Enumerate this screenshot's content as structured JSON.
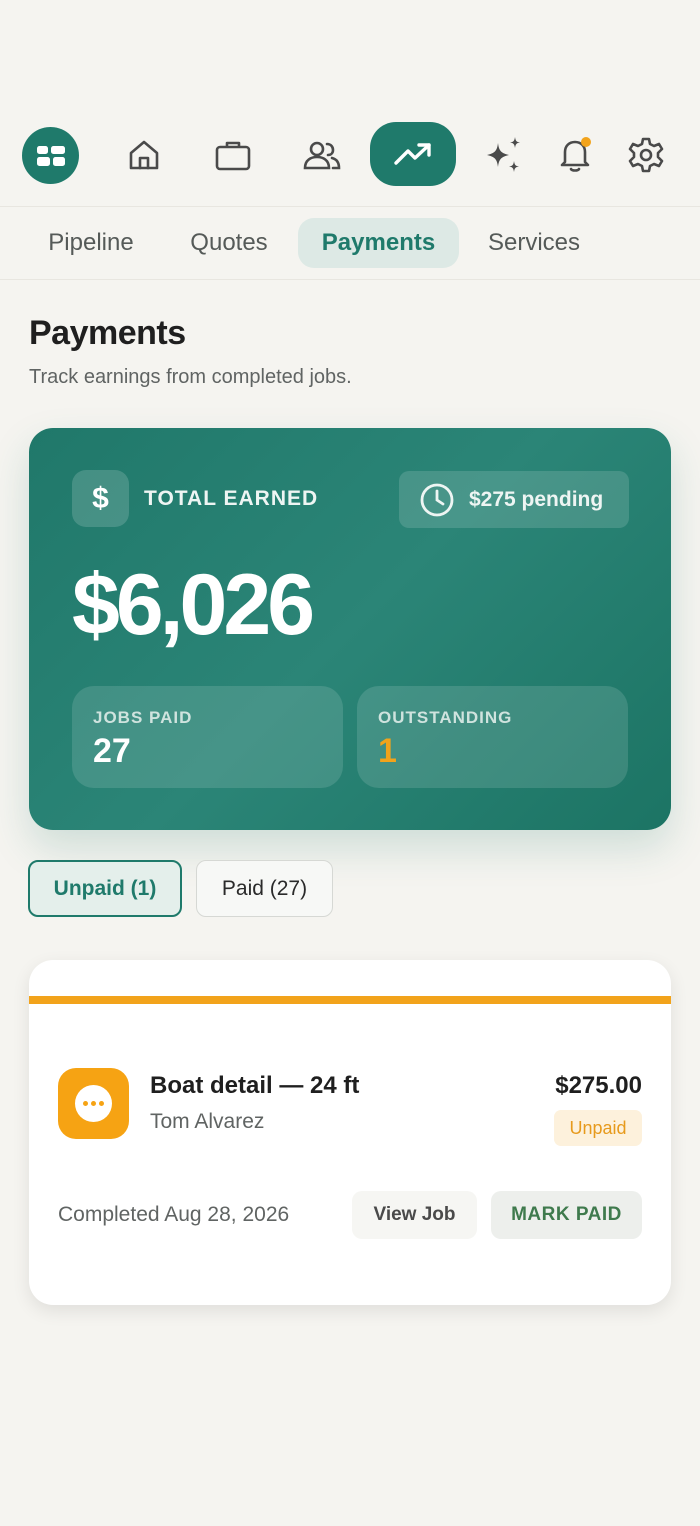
{
  "colors": {
    "brand": "#1f7a6b",
    "accent_orange": "#f2a31b",
    "background": "#f5f4f0"
  },
  "topnav": {
    "items": [
      {
        "icon": "dashboard-grid-icon"
      },
      {
        "icon": "home-icon"
      },
      {
        "icon": "briefcase-icon"
      },
      {
        "icon": "users-icon"
      },
      {
        "icon": "trending-up-icon",
        "active": true
      },
      {
        "icon": "sparkles-icon"
      },
      {
        "icon": "bell-icon",
        "has_notification": true
      },
      {
        "icon": "gear-icon"
      }
    ]
  },
  "tabs": {
    "pipeline": "Pipeline",
    "quotes": "Quotes",
    "payments": "Payments",
    "services": "Services",
    "active": "payments"
  },
  "header": {
    "title": "Payments",
    "subtitle": "Track earnings from completed jobs."
  },
  "summary": {
    "dollar_symbol": "$",
    "total_label": "TOTAL EARNED",
    "pending": "$275 pending",
    "total_amount": "$6,026",
    "jobs_paid_label": "JOBS PAID",
    "jobs_paid_value": "27",
    "outstanding_label": "OUTSTANDING",
    "outstanding_value": "1"
  },
  "filters": {
    "unpaid": "Unpaid (1)",
    "paid": "Paid (27)",
    "selected": "unpaid"
  },
  "job": {
    "title": "Boat detail — 24 ft",
    "client": "Tom Alvarez",
    "amount": "$275.00",
    "status": "Unpaid",
    "completed": "Completed Aug 28, 2026",
    "view_label": "View Job",
    "mark_label": "MARK PAID"
  }
}
